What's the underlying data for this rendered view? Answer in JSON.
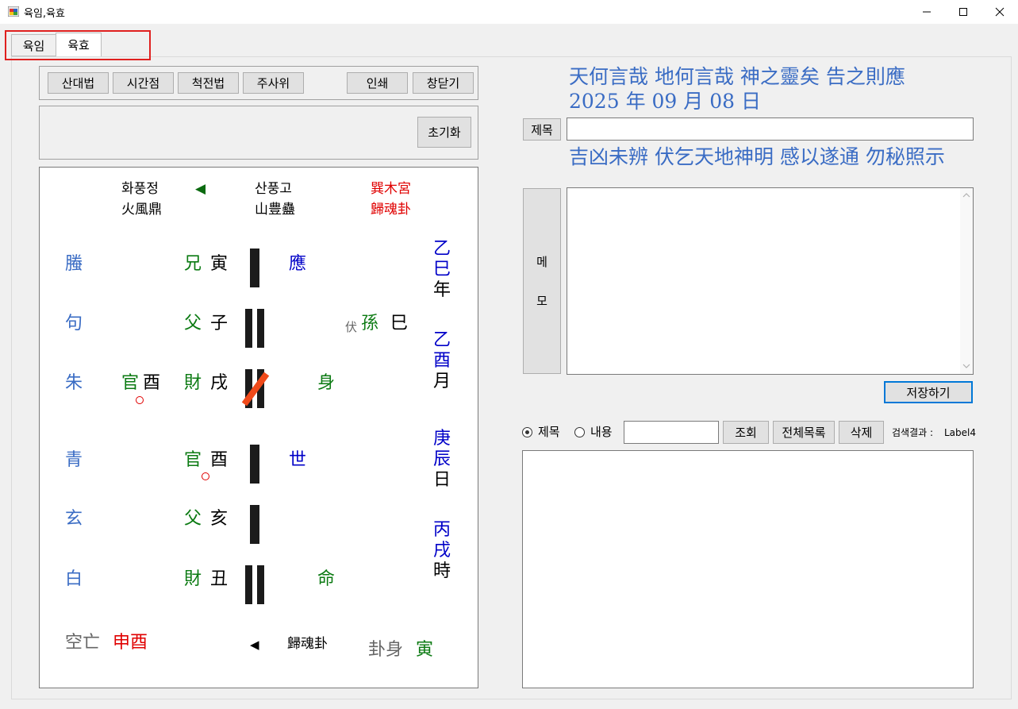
{
  "window": {
    "title": "육임,육효",
    "minimize": "—",
    "maximize": "☐",
    "close": "✕"
  },
  "tabs": [
    {
      "label": "육임"
    },
    {
      "label": "육효"
    }
  ],
  "toolbar": {
    "buttons": [
      "산대법",
      "시간점",
      "척전법",
      "주사위",
      "인쇄",
      "창닫기"
    ],
    "reset": "초기화"
  },
  "hexagram": {
    "changed_name_kr": "화풍정",
    "changed_name_hanja": "火風鼎",
    "arrow_left": "◀",
    "original_name_kr": "산풍고",
    "original_name_hanja": "山豊蠱",
    "palace": "巽木宮",
    "palace_type": "歸魂卦",
    "spirits": [
      "螣",
      "句",
      "朱",
      "青",
      "玄",
      "白"
    ],
    "relations": [
      "兄",
      "父",
      "財",
      "官",
      "父",
      "財"
    ],
    "branches": [
      "寅",
      "子",
      "戌",
      "酉",
      "亥",
      "丑"
    ],
    "hidden_relation": "官",
    "hidden_branch": "酉",
    "markers": {
      "ying": "應",
      "shi": "世",
      "body": "身",
      "life": "命"
    },
    "fu_label": "伏",
    "fu_relation": "孫",
    "fu_branch": "巳",
    "date_columns": [
      {
        "gan": "乙",
        "zhi": "巳",
        "unit": "年"
      },
      {
        "gan": "乙",
        "zhi": "酉",
        "unit": "月"
      },
      {
        "gan": "庚",
        "zhi": "辰",
        "unit": "日"
      },
      {
        "gan": "丙",
        "zhi": "戌",
        "unit": "時"
      }
    ],
    "kongwang_label": "空亡",
    "kongwang_value": "申酉",
    "arrow_bottom": "◀",
    "bottom_palace_type": "歸魂卦",
    "guashen_label": "卦身",
    "guashen_value": "寅"
  },
  "header": {
    "line1": "天何言哉 地何言哉 神之靈矣 告之則應",
    "line2": "2025 年 09 月 08 日",
    "line3": "吉凶未辨 伏乞天地神明 感以遂通 勿秘照示"
  },
  "form": {
    "title_label": "제목",
    "title_value": "",
    "memo_label_1": "메",
    "memo_label_2": "모",
    "memo_value": "",
    "save": "저장하기"
  },
  "search": {
    "radio_title": "제목",
    "radio_content": "내용",
    "query": "",
    "lookup": "조회",
    "all_list": "전체목록",
    "delete": "삭제",
    "result_label": "검색결과 :",
    "result_value": "Label4"
  },
  "colors": {
    "accent_blue": "#3a6cc4",
    "green": "#0b7a12",
    "red": "#e00000",
    "navy": "#0000c8",
    "slash": "#f04a1a",
    "tab_highlight": "#e0201f"
  }
}
